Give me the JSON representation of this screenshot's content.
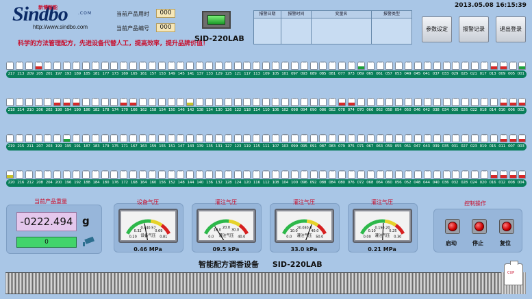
{
  "header": {
    "logo_text": "Sindbo",
    "logo_cn": "新博智能",
    "logo_com": ".COM",
    "logo_url": "http://www.sindbo.com",
    "slogan": "科学的方法管理配方，先进设备代替人工，提高效率，提升品牌价值！",
    "product_time_label": "当前产品用时",
    "product_time_value": "000",
    "product_number_label": "当前产品编号",
    "product_number_value": "000",
    "model": "SID-220LAB",
    "datetime": "2013.05.08   16:15:39"
  },
  "alarm_table": {
    "columns": [
      "报警日期",
      "报警时间",
      "变量名",
      "报警类型"
    ]
  },
  "buttons": {
    "params": "参数设定",
    "alarm_log": "报警记录",
    "logout": "退出登录"
  },
  "bottle_rows": [
    {
      "labels": [
        "217",
        "213",
        "209",
        "205",
        "201",
        "197",
        "193",
        "189",
        "185",
        "181",
        "177",
        "173",
        "169",
        "165",
        "161",
        "157",
        "153",
        "149",
        "145",
        "141",
        "137",
        "133",
        "129",
        "125",
        "121",
        "117",
        "113",
        "109",
        "105",
        "101",
        "097",
        "093",
        "089",
        "085",
        "081",
        "077",
        "073",
        "069",
        "065",
        "061",
        "057",
        "053",
        "049",
        "045",
        "041",
        "037",
        "033",
        "029",
        "025",
        "021",
        "017",
        "013",
        "009",
        "005",
        "001"
      ],
      "fills": {
        "3": "#d62828",
        "37": "#1aa33a",
        "51": "#d62828",
        "52": "#d62828",
        "54": "#1aa33a"
      }
    },
    {
      "labels": [
        "218",
        "214",
        "210",
        "206",
        "202",
        "198",
        "194",
        "190",
        "186",
        "182",
        "178",
        "174",
        "170",
        "166",
        "162",
        "158",
        "154",
        "150",
        "146",
        "142",
        "138",
        "134",
        "130",
        "126",
        "122",
        "118",
        "114",
        "110",
        "106",
        "102",
        "098",
        "094",
        "090",
        "086",
        "082",
        "078",
        "074",
        "070",
        "066",
        "062",
        "058",
        "054",
        "050",
        "046",
        "042",
        "038",
        "034",
        "030",
        "026",
        "022",
        "018",
        "014",
        "010",
        "006",
        "002"
      ],
      "fills": {
        "5": "#d62828",
        "6": "#d62828",
        "7": "#d62828",
        "12": "#d62828",
        "13": "#d62828",
        "19": "#c6c22a",
        "35": "#d62828",
        "36": "#d62828",
        "52": "#d62828",
        "53": "#d62828",
        "54": "#d62828"
      }
    },
    {
      "labels": [
        "219",
        "215",
        "211",
        "207",
        "203",
        "199",
        "195",
        "191",
        "187",
        "183",
        "179",
        "175",
        "171",
        "167",
        "163",
        "159",
        "155",
        "151",
        "147",
        "143",
        "139",
        "135",
        "131",
        "127",
        "123",
        "119",
        "115",
        "111",
        "107",
        "103",
        "099",
        "095",
        "091",
        "087",
        "083",
        "079",
        "075",
        "071",
        "067",
        "063",
        "059",
        "055",
        "051",
        "047",
        "043",
        "039",
        "035",
        "031",
        "027",
        "023",
        "019",
        "015",
        "011",
        "007",
        "003"
      ],
      "fills": {
        "6": "#1aa33a",
        "52": "#d62828",
        "53": "#d62828",
        "54": "#d62828"
      }
    },
    {
      "labels": [
        "220",
        "216",
        "212",
        "208",
        "204",
        "200",
        "196",
        "192",
        "188",
        "184",
        "180",
        "176",
        "172",
        "168",
        "164",
        "160",
        "156",
        "152",
        "148",
        "144",
        "140",
        "136",
        "132",
        "128",
        "124",
        "120",
        "116",
        "112",
        "108",
        "104",
        "100",
        "096",
        "092",
        "088",
        "084",
        "080",
        "076",
        "072",
        "068",
        "064",
        "060",
        "056",
        "052",
        "048",
        "044",
        "040",
        "036",
        "032",
        "028",
        "024",
        "020",
        "016",
        "012",
        "008",
        "004"
      ],
      "fills": {
        "0": "#c6c22a",
        "51": "#d62828",
        "52": "#d62828",
        "53": "#d62828",
        "54": "#d62828"
      }
    }
  ],
  "weight": {
    "title": "当前产品重量",
    "value": "-0222.494",
    "unit": "g",
    "bar_value": "0"
  },
  "gauges": [
    {
      "title": "设备气压",
      "face_label": "设备气压",
      "reading": "0.46 MPa",
      "ticks": [
        "0.20",
        "0.32",
        "0.44",
        "0.57",
        "0.69",
        "0.81"
      ],
      "fraction": 0.42
    },
    {
      "title": "灌注气压",
      "face_label": "灌注气压",
      "reading": "09.5 kPa",
      "ticks": [
        "0.0",
        "10.0",
        "20.0",
        "30.0",
        "40.0"
      ],
      "fraction": 0.24
    },
    {
      "title": "灌注气压",
      "face_label": "灌注气压",
      "reading": "33.0 kPa",
      "ticks": [
        "0.0",
        "10.0",
        "20.0",
        "30.0",
        "40.0",
        "50.0"
      ],
      "fraction": 0.66
    },
    {
      "title": "灌注气压",
      "face_label": "灌注气压",
      "reading": "0.21 MPa",
      "ticks": [
        "0.00",
        "0.10",
        "0.15",
        "0.20",
        "0.25",
        "0.30"
      ],
      "fraction": 0.52
    }
  ],
  "control": {
    "title": "控制操作",
    "start": "启动",
    "stop": "停止",
    "reset": "复位"
  },
  "footer": {
    "title": "智能配方调香设备",
    "model": "SID-220LAB"
  },
  "cup": {
    "label": "CUP"
  },
  "colors": {
    "background": "#a9c6e6",
    "lane": "#0a7e5a",
    "alarm_red": "#c8102e"
  }
}
